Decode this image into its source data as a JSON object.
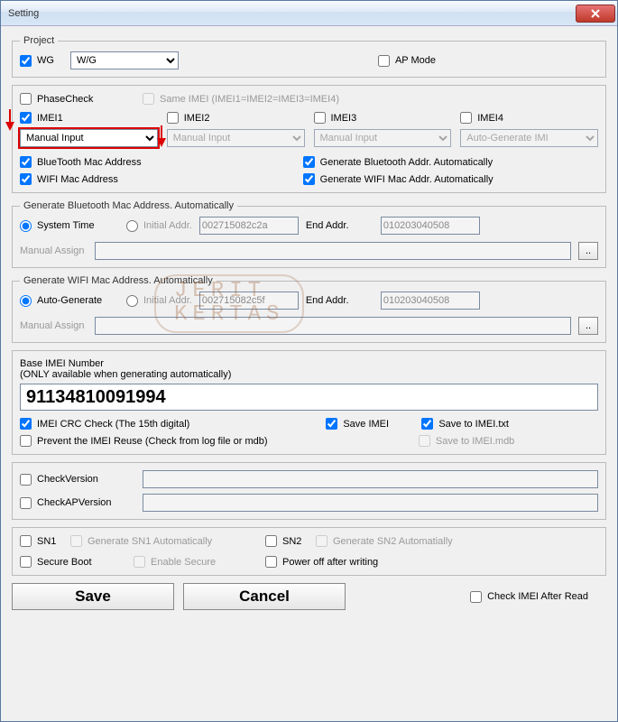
{
  "window": {
    "title": "Setting"
  },
  "project": {
    "legend": "Project",
    "wg_label": "WG",
    "wg_checked": true,
    "wg_select": "W/G",
    "ap_label": "AP Mode",
    "ap_checked": false
  },
  "main": {
    "phasecheck_label": "PhaseCheck",
    "phasecheck_checked": false,
    "sameimei_label": "Same IMEI (IMEI1=IMEI2=IMEI3=IMEI4)",
    "sameimei_checked": false,
    "imei": [
      {
        "label": "IMEI1",
        "checked": true,
        "mode": "Manual Input"
      },
      {
        "label": "IMEI2",
        "checked": false,
        "mode": "Manual Input"
      },
      {
        "label": "IMEI3",
        "checked": false,
        "mode": "Manual Input"
      },
      {
        "label": "IMEI4",
        "checked": false,
        "mode": "Auto-Generate IMI"
      }
    ],
    "bt_label": "BlueTooth Mac Address",
    "bt_checked": true,
    "bt_auto_label": "Generate Bluetooth Addr. Automatically",
    "bt_auto_checked": true,
    "wifi_label": "WIFI Mac Address",
    "wifi_checked": true,
    "wifi_auto_label": "Generate WIFI Mac Addr. Automatically",
    "wifi_auto_checked": true
  },
  "bt_gen": {
    "legend": "Generate Bluetooth Mac Address. Automatically",
    "system_time_label": "System Time",
    "initial_label": "Initial Addr.",
    "initial_value": "002715082c2a",
    "end_label": "End Addr.",
    "end_value": "010203040508",
    "manual_label": "Manual Assign",
    "manual_value": "",
    "browse": ".."
  },
  "wifi_gen": {
    "legend": "Generate WIFI Mac Address. Automatically",
    "auto_label": "Auto-Generate",
    "initial_label": "Initial Addr.",
    "initial_value": "002715082c5f",
    "end_label": "End Addr.",
    "end_value": "010203040508",
    "manual_label": "Manual Assign",
    "manual_value": "",
    "browse": ".."
  },
  "base_imei": {
    "title": "Base IMEI Number",
    "subtitle": "(ONLY available when generating automatically)",
    "value": "91134810091994",
    "crc_label": "IMEI CRC Check (The 15th digital)",
    "crc_checked": true,
    "save_label": "Save IMEI",
    "save_checked": true,
    "save_txt_label": "Save to IMEI.txt",
    "save_txt_checked": true,
    "reuse_label": "Prevent the IMEI Reuse (Check from log file or mdb)",
    "reuse_checked": false,
    "save_mdb_label": "Save to IMEI.mdb",
    "save_mdb_checked": false
  },
  "version": {
    "checkver_label": "CheckVersion",
    "checkver_checked": false,
    "checkap_label": "CheckAPVersion",
    "checkap_checked": false
  },
  "sn": {
    "sn1_label": "SN1",
    "sn1_checked": false,
    "gen1_label": "Generate SN1 Automatically",
    "sn2_label": "SN2",
    "sn2_checked": false,
    "gen2_label": "Generate SN2 Automatially",
    "secure_label": "Secure Boot",
    "secure_checked": false,
    "enable_secure_label": "Enable Secure",
    "poweroff_label": "Power off after writing",
    "poweroff_checked": false
  },
  "footer": {
    "save": "Save",
    "cancel": "Cancel",
    "check_after_label": "Check IMEI After Read",
    "check_after_checked": false
  },
  "watermark": {
    "line1": "JERIT",
    "line2": "KERTAS"
  }
}
